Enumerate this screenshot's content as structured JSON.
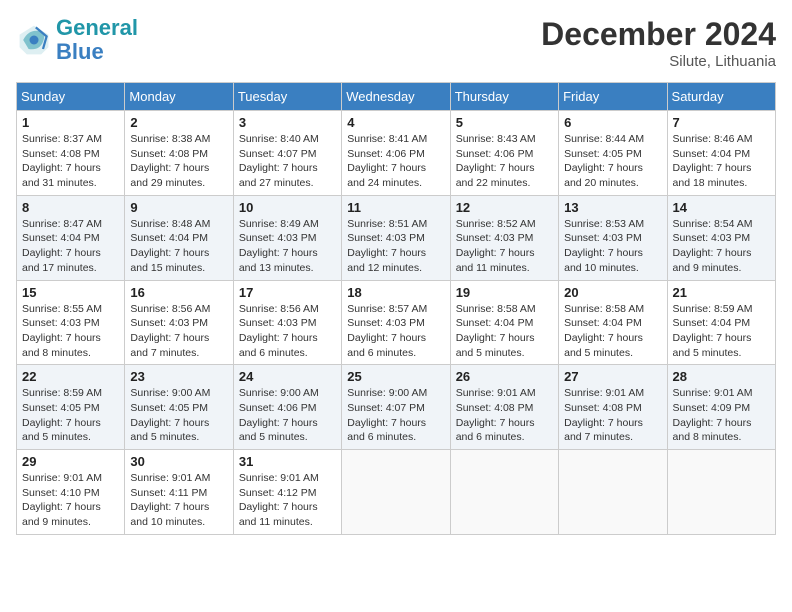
{
  "header": {
    "logo_line1": "General",
    "logo_line2": "Blue",
    "month_year": "December 2024",
    "location": "Silute, Lithuania"
  },
  "weekdays": [
    "Sunday",
    "Monday",
    "Tuesday",
    "Wednesday",
    "Thursday",
    "Friday",
    "Saturday"
  ],
  "weeks": [
    [
      {
        "day": "1",
        "info": "Sunrise: 8:37 AM\nSunset: 4:08 PM\nDaylight: 7 hours\nand 31 minutes."
      },
      {
        "day": "2",
        "info": "Sunrise: 8:38 AM\nSunset: 4:08 PM\nDaylight: 7 hours\nand 29 minutes."
      },
      {
        "day": "3",
        "info": "Sunrise: 8:40 AM\nSunset: 4:07 PM\nDaylight: 7 hours\nand 27 minutes."
      },
      {
        "day": "4",
        "info": "Sunrise: 8:41 AM\nSunset: 4:06 PM\nDaylight: 7 hours\nand 24 minutes."
      },
      {
        "day": "5",
        "info": "Sunrise: 8:43 AM\nSunset: 4:06 PM\nDaylight: 7 hours\nand 22 minutes."
      },
      {
        "day": "6",
        "info": "Sunrise: 8:44 AM\nSunset: 4:05 PM\nDaylight: 7 hours\nand 20 minutes."
      },
      {
        "day": "7",
        "info": "Sunrise: 8:46 AM\nSunset: 4:04 PM\nDaylight: 7 hours\nand 18 minutes."
      }
    ],
    [
      {
        "day": "8",
        "info": "Sunrise: 8:47 AM\nSunset: 4:04 PM\nDaylight: 7 hours\nand 17 minutes."
      },
      {
        "day": "9",
        "info": "Sunrise: 8:48 AM\nSunset: 4:04 PM\nDaylight: 7 hours\nand 15 minutes."
      },
      {
        "day": "10",
        "info": "Sunrise: 8:49 AM\nSunset: 4:03 PM\nDaylight: 7 hours\nand 13 minutes."
      },
      {
        "day": "11",
        "info": "Sunrise: 8:51 AM\nSunset: 4:03 PM\nDaylight: 7 hours\nand 12 minutes."
      },
      {
        "day": "12",
        "info": "Sunrise: 8:52 AM\nSunset: 4:03 PM\nDaylight: 7 hours\nand 11 minutes."
      },
      {
        "day": "13",
        "info": "Sunrise: 8:53 AM\nSunset: 4:03 PM\nDaylight: 7 hours\nand 10 minutes."
      },
      {
        "day": "14",
        "info": "Sunrise: 8:54 AM\nSunset: 4:03 PM\nDaylight: 7 hours\nand 9 minutes."
      }
    ],
    [
      {
        "day": "15",
        "info": "Sunrise: 8:55 AM\nSunset: 4:03 PM\nDaylight: 7 hours\nand 8 minutes."
      },
      {
        "day": "16",
        "info": "Sunrise: 8:56 AM\nSunset: 4:03 PM\nDaylight: 7 hours\nand 7 minutes."
      },
      {
        "day": "17",
        "info": "Sunrise: 8:56 AM\nSunset: 4:03 PM\nDaylight: 7 hours\nand 6 minutes."
      },
      {
        "day": "18",
        "info": "Sunrise: 8:57 AM\nSunset: 4:03 PM\nDaylight: 7 hours\nand 6 minutes."
      },
      {
        "day": "19",
        "info": "Sunrise: 8:58 AM\nSunset: 4:04 PM\nDaylight: 7 hours\nand 5 minutes."
      },
      {
        "day": "20",
        "info": "Sunrise: 8:58 AM\nSunset: 4:04 PM\nDaylight: 7 hours\nand 5 minutes."
      },
      {
        "day": "21",
        "info": "Sunrise: 8:59 AM\nSunset: 4:04 PM\nDaylight: 7 hours\nand 5 minutes."
      }
    ],
    [
      {
        "day": "22",
        "info": "Sunrise: 8:59 AM\nSunset: 4:05 PM\nDaylight: 7 hours\nand 5 minutes."
      },
      {
        "day": "23",
        "info": "Sunrise: 9:00 AM\nSunset: 4:05 PM\nDaylight: 7 hours\nand 5 minutes."
      },
      {
        "day": "24",
        "info": "Sunrise: 9:00 AM\nSunset: 4:06 PM\nDaylight: 7 hours\nand 5 minutes."
      },
      {
        "day": "25",
        "info": "Sunrise: 9:00 AM\nSunset: 4:07 PM\nDaylight: 7 hours\nand 6 minutes."
      },
      {
        "day": "26",
        "info": "Sunrise: 9:01 AM\nSunset: 4:08 PM\nDaylight: 7 hours\nand 6 minutes."
      },
      {
        "day": "27",
        "info": "Sunrise: 9:01 AM\nSunset: 4:08 PM\nDaylight: 7 hours\nand 7 minutes."
      },
      {
        "day": "28",
        "info": "Sunrise: 9:01 AM\nSunset: 4:09 PM\nDaylight: 7 hours\nand 8 minutes."
      }
    ],
    [
      {
        "day": "29",
        "info": "Sunrise: 9:01 AM\nSunset: 4:10 PM\nDaylight: 7 hours\nand 9 minutes."
      },
      {
        "day": "30",
        "info": "Sunrise: 9:01 AM\nSunset: 4:11 PM\nDaylight: 7 hours\nand 10 minutes."
      },
      {
        "day": "31",
        "info": "Sunrise: 9:01 AM\nSunset: 4:12 PM\nDaylight: 7 hours\nand 11 minutes."
      },
      null,
      null,
      null,
      null
    ]
  ]
}
